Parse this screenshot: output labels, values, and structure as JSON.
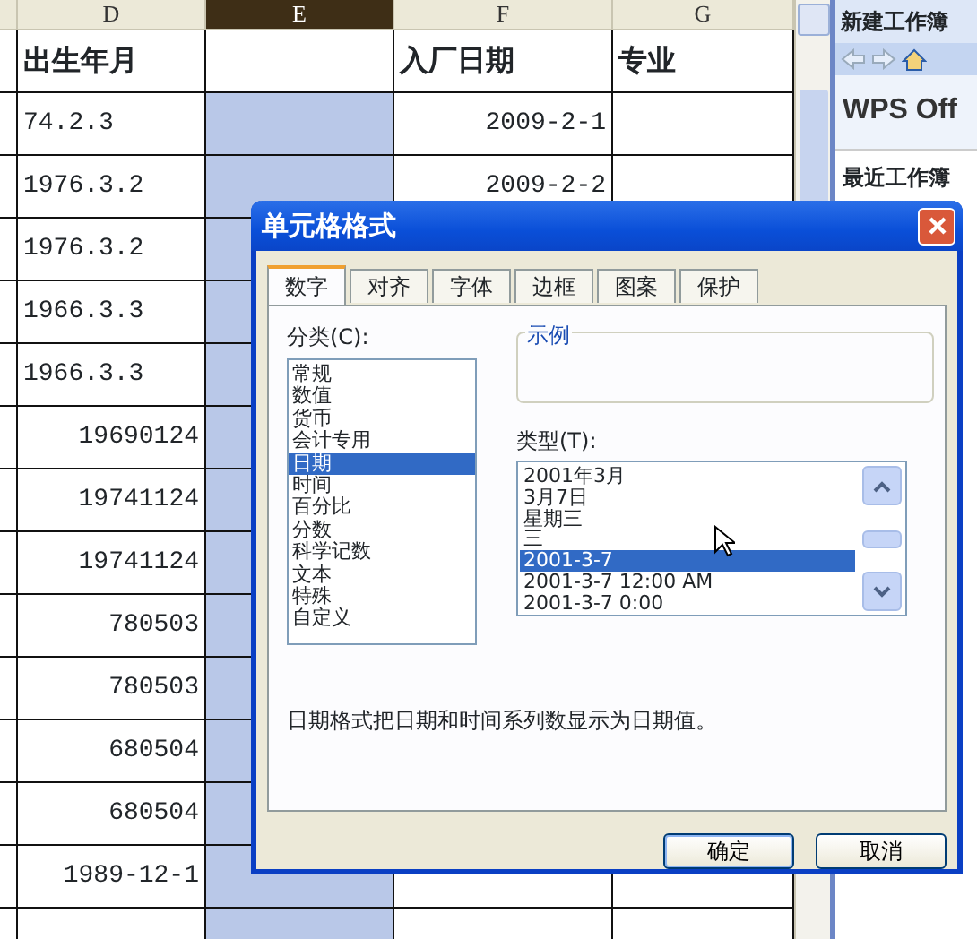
{
  "sheet": {
    "columns": [
      {
        "label": "D",
        "heading": "出生年月",
        "selected": false
      },
      {
        "label": "E",
        "selected": true
      },
      {
        "label": "F",
        "heading": "入厂日期",
        "selected": false
      },
      {
        "label": "G",
        "heading": "专业",
        "selected": false
      }
    ],
    "rows": [
      {
        "d": "74.2.3",
        "f": "2009-2-1"
      },
      {
        "d": "1976.3.2",
        "f": "2009-2-2"
      },
      {
        "d": "1976.3.2"
      },
      {
        "d": "1966.3.3"
      },
      {
        "d": "1966.3.3"
      },
      {
        "d": "19690124"
      },
      {
        "d": "19741124"
      },
      {
        "d": "19741124"
      },
      {
        "d": "780503"
      },
      {
        "d": "780503"
      },
      {
        "d": "680504"
      },
      {
        "d": "680504"
      },
      {
        "d": "1989-12-1"
      }
    ]
  },
  "task_pane": {
    "title": "新建工作簿",
    "logo": "WPS Off",
    "section": "最近工作簿"
  },
  "dialog": {
    "title": "单元格格式",
    "tabs": [
      {
        "label": "数字",
        "selected": true
      },
      {
        "label": "对齐",
        "selected": false
      },
      {
        "label": "字体",
        "selected": false
      },
      {
        "label": "边框",
        "selected": false
      },
      {
        "label": "图案",
        "selected": false
      },
      {
        "label": "保护",
        "selected": false
      }
    ],
    "category_label": "分类(C):",
    "categories": [
      {
        "label": "常规",
        "selected": false
      },
      {
        "label": "数值",
        "selected": false
      },
      {
        "label": "货币",
        "selected": false
      },
      {
        "label": "会计专用",
        "selected": false
      },
      {
        "label": "日期",
        "selected": true
      },
      {
        "label": "时间",
        "selected": false
      },
      {
        "label": "百分比",
        "selected": false
      },
      {
        "label": "分数",
        "selected": false
      },
      {
        "label": "科学记数",
        "selected": false
      },
      {
        "label": "文本",
        "selected": false
      },
      {
        "label": "特殊",
        "selected": false
      },
      {
        "label": "自定义",
        "selected": false
      }
    ],
    "sample_label": "示例",
    "type_label": "类型(T):",
    "types": [
      {
        "label": "2001年3月",
        "selected": false
      },
      {
        "label": "3月7日",
        "selected": false
      },
      {
        "label": "星期三",
        "selected": false
      },
      {
        "label": "三",
        "selected": false
      },
      {
        "label": "2001-3-7",
        "selected": true
      },
      {
        "label": "2001-3-7 12:00 AM",
        "selected": false
      },
      {
        "label": "2001-3-7 0:00",
        "selected": false
      }
    ],
    "description": "日期格式把日期和时间系列数显示为日期值。",
    "buttons": [
      {
        "label": "确定",
        "default": true
      },
      {
        "label": "取消",
        "default": false
      }
    ]
  }
}
